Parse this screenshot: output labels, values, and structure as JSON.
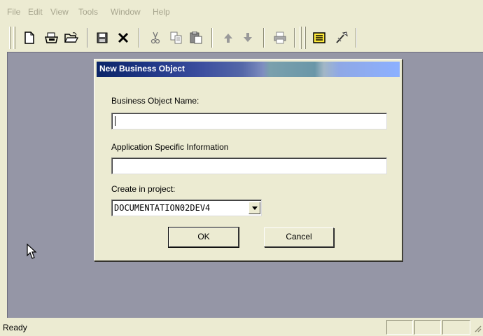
{
  "menu": [
    "File",
    "Edit",
    "View",
    "Tools",
    "Window",
    "Help"
  ],
  "toolbar": {
    "icons": [
      "new-document-icon",
      "open-project-icon",
      "open-folder-icon",
      "save-icon",
      "delete-icon",
      "cut-icon",
      "copy-icon",
      "paste-icon",
      "move-up-icon",
      "move-down-icon",
      "print-icon",
      "properties-icon",
      "tools-icon"
    ]
  },
  "dialog": {
    "title": "New Business Object",
    "name_label": "Business Object Name:",
    "name_value": "",
    "asi_label": "Application Specific Information",
    "asi_value": "",
    "project_label": "Create in project:",
    "project_value": "DOCUMENTATION02DEV4",
    "ok_label": "OK",
    "cancel_label": "Cancel"
  },
  "status": {
    "text": "Ready"
  },
  "colors": {
    "background": "#ecebd2",
    "workspace": "#9596a6",
    "title_start": "#0a2467",
    "title_end": "#8cb0ff",
    "disabled_menu_text": "#a7a58e"
  }
}
